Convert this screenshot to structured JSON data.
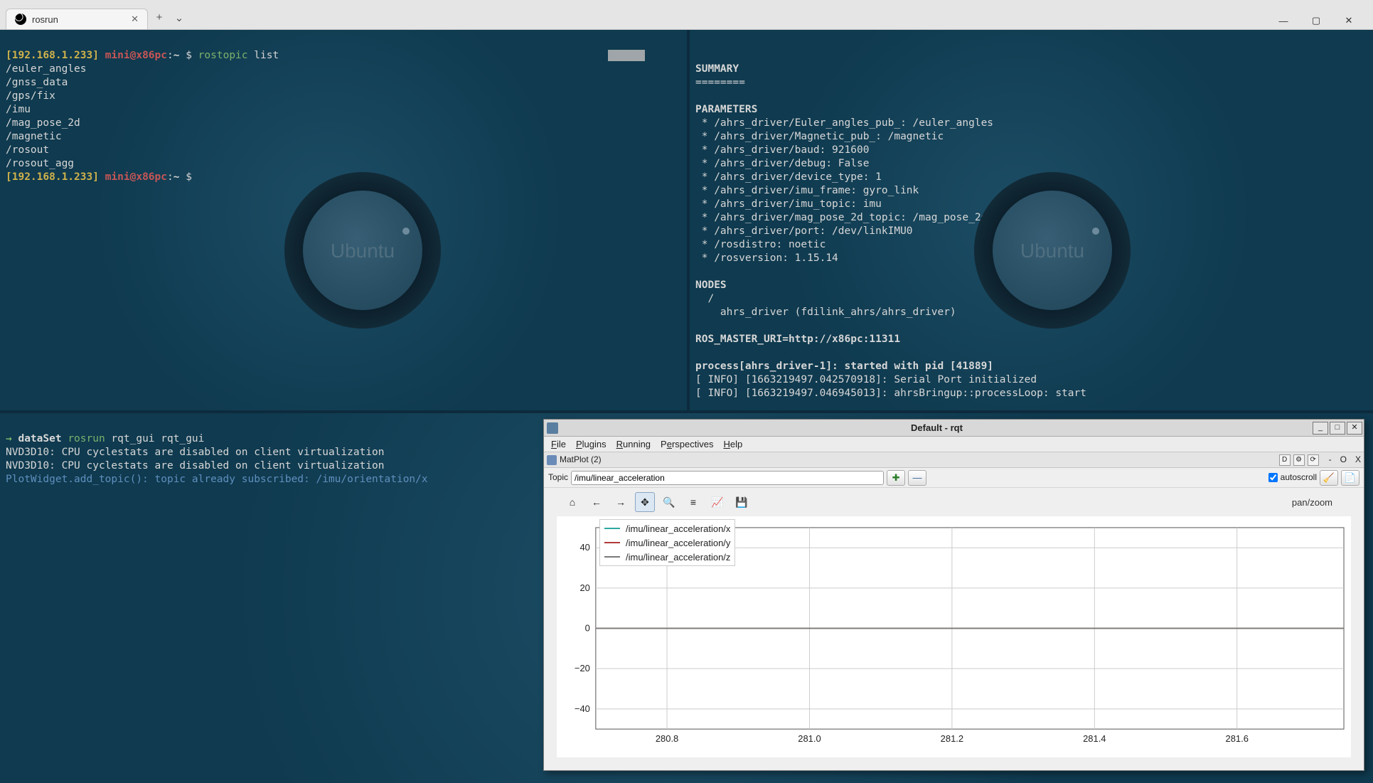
{
  "window": {
    "tab_title": "rosrun",
    "add_tab": "+",
    "tab_chevron": "⌄",
    "btn_min": "—",
    "btn_max": "▢",
    "btn_close": "✕"
  },
  "term_tl": {
    "prompt_open": "[192.168.1.233]",
    "prompt_user": "mini@x86pc",
    "prompt_sep": ":",
    "prompt_path": "~",
    "prompt_sym": "$",
    "cmd_tool": "rostopic",
    "cmd_arg": "list",
    "topics": [
      "/euler_angles",
      "/gnss_data",
      "/gps/fix",
      "/imu",
      "/mag_pose_2d",
      "/magnetic",
      "/rosout",
      "/rosout_agg"
    ],
    "prompt2_open": "[192.168.1.233]",
    "prompt2_user": "mini@x86pc",
    "prompt2_sep": ":",
    "prompt2_path": "~",
    "prompt2_sym": "$",
    "ubuntu": "Ubuntu"
  },
  "term_tr": {
    "summary": "SUMMARY",
    "sep": "========",
    "parameters": "PARAMETERS",
    "params": [
      " * /ahrs_driver/Euler_angles_pub_: /euler_angles",
      " * /ahrs_driver/Magnetic_pub_: /magnetic",
      " * /ahrs_driver/baud: 921600",
      " * /ahrs_driver/debug: False",
      " * /ahrs_driver/device_type: 1",
      " * /ahrs_driver/imu_frame: gyro_link",
      " * /ahrs_driver/imu_topic: imu",
      " * /ahrs_driver/mag_pose_2d_topic: /mag_pose_2d",
      " * /ahrs_driver/port: /dev/linkIMU0",
      " * /rosdistro: noetic",
      " * /rosversion: 1.15.14"
    ],
    "nodes": "NODES",
    "node_slash": "  /",
    "node_line": "    ahrs_driver (fdilink_ahrs/ahrs_driver)",
    "master": "ROS_MASTER_URI=http://x86pc:11311",
    "proc": "process[ahrs_driver-1]: started with pid [41889]",
    "info1": "[ INFO] [1663219497.042570918]: Serial Port initialized",
    "info2": "[ INFO] [1663219497.046945013]: ahrsBringup::processLoop: start",
    "ubuntu": "Ubuntu"
  },
  "term_b": {
    "arrow": "→ ",
    "workdir": "dataSet",
    "cmd_tool": "rosrun",
    "cmd_rest": " rqt_gui rqt_gui",
    "l1": "NVD3D10: CPU cyclestats are disabled on client virtualization",
    "l2": "NVD3D10: CPU cyclestats are disabled on client virtualization",
    "l3": "PlotWidget.add_topic(): topic already subscribed: /imu/orientation/x"
  },
  "rqt": {
    "title": "Default - rqt",
    "btn_min": "_",
    "btn_max": "□",
    "btn_close": "✕",
    "menu": {
      "file": "File",
      "plugins": "Plugins",
      "running": "Running",
      "perspectives": "Perspectives",
      "help": "Help"
    },
    "dock_label": "MatPlot (2)",
    "dock_right": {
      "d": "D",
      "gear": "⚙",
      "reload": "⟳",
      "dash": "-",
      "o": "O",
      "x": "X"
    },
    "toolbar": {
      "topic_label": "Topic",
      "topic_value": "/imu/linear_acceleration",
      "add": "✚",
      "remove": "—",
      "autoscroll": "autoscroll",
      "clear": "🧹",
      "export": "📄"
    },
    "plotbar": {
      "home": "⌂",
      "back": "←",
      "forward": "→",
      "pan": "✥",
      "zoom": "🔍",
      "subplots": "≡",
      "axes": "📈",
      "save": "💾",
      "mode": "pan/zoom"
    },
    "legend": {
      "s0": "/imu/linear_acceleration/x",
      "s1": "/imu/linear_acceleration/y",
      "s2": "/imu/linear_acceleration/z"
    }
  },
  "chart_data": {
    "type": "line",
    "x_ticks": [
      280.8,
      281.0,
      281.2,
      281.4,
      281.6
    ],
    "y_ticks": [
      -40,
      -20,
      0,
      20,
      40
    ],
    "xlim": [
      280.7,
      281.75
    ],
    "ylim": [
      -50,
      50
    ],
    "series": [
      {
        "name": "/imu/linear_acceleration/x",
        "color": "#2ca8a0",
        "values": {
          "280.7": 0,
          "281.75": 0
        }
      },
      {
        "name": "/imu/linear_acceleration/y",
        "color": "#b23a3a",
        "values": {
          "280.7": 0,
          "281.75": 0
        }
      },
      {
        "name": "/imu/linear_acceleration/z",
        "color": "#7a7a7a",
        "values": {
          "280.7": 0,
          "281.75": 0
        }
      }
    ],
    "title": "",
    "xlabel": "",
    "ylabel": ""
  }
}
